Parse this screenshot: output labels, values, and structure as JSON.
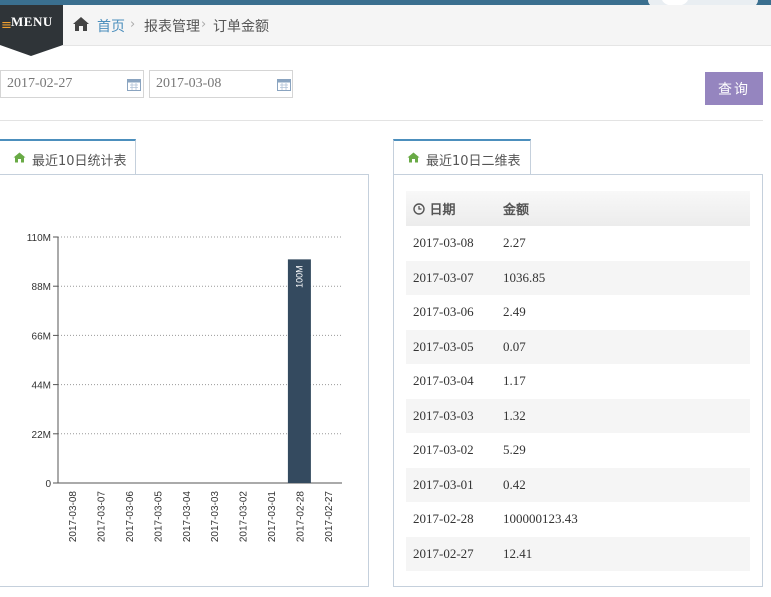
{
  "header": {
    "menu_label": "MENU",
    "breadcrumbs": [
      "首页",
      "报表管理",
      "订单金额"
    ]
  },
  "filters": {
    "start_date": "2017-02-27",
    "end_date": "2017-03-08",
    "query_label": "查询"
  },
  "tabs": {
    "chart_tab": "最近10日统计表",
    "table_tab": "最近10日二维表"
  },
  "table": {
    "columns": [
      "日期",
      "金额"
    ],
    "rows": [
      [
        "2017-03-08",
        "2.27"
      ],
      [
        "2017-03-07",
        "1036.85"
      ],
      [
        "2017-03-06",
        "2.49"
      ],
      [
        "2017-03-05",
        "0.07"
      ],
      [
        "2017-03-04",
        "1.17"
      ],
      [
        "2017-03-03",
        "1.32"
      ],
      [
        "2017-03-02",
        "5.29"
      ],
      [
        "2017-03-01",
        "0.42"
      ],
      [
        "2017-02-28",
        "100000123.43"
      ],
      [
        "2017-02-27",
        "12.41"
      ]
    ]
  },
  "chart_data": {
    "type": "bar",
    "categories": [
      "2017-03-08",
      "2017-03-07",
      "2017-03-06",
      "2017-03-05",
      "2017-03-04",
      "2017-03-03",
      "2017-03-02",
      "2017-03-01",
      "2017-02-28",
      "2017-02-27"
    ],
    "values": [
      2.27,
      1036.85,
      2.49,
      0.07,
      1.17,
      1.32,
      5.29,
      0.42,
      100000123.43,
      12.41
    ],
    "data_labels": [
      "",
      "",
      "",
      "",
      "",
      "",
      "",
      "",
      "100M",
      ""
    ],
    "y_ticks": [
      0,
      22000000,
      44000000,
      66000000,
      88000000,
      110000000
    ],
    "y_tick_labels": [
      "0",
      "22M",
      "44M",
      "66M",
      "88M",
      "110M"
    ],
    "ylim": [
      0,
      110000000
    ],
    "bar_color": "#344a5f",
    "grid": true,
    "grid_style": "dotted"
  }
}
